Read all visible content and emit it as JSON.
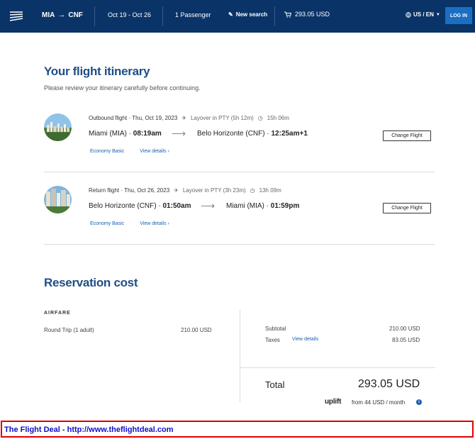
{
  "header": {
    "origin": "MIA",
    "destination": "CNF",
    "dates": "Oct 19 - Oct 26",
    "passengers": "1 Passenger",
    "new_search": "New search",
    "cart_total": "293.05 USD",
    "locale": "US / EN",
    "login": "LOG IN",
    "colors": {
      "header_bg": "#0a3468",
      "login_bg": "#1a6fc2"
    }
  },
  "itinerary": {
    "title": "Your flight itinerary",
    "subtitle": "Please review your itinerary carefully before continuing.",
    "flights": [
      {
        "label_bold": "Outbound flight",
        "date": " · Thu, Oct 19, 2023",
        "layover": "Layover in PTY (5h 12m)",
        "duration": "15h 06m",
        "origin": "Miami (MIA)",
        "depart_time": "08:19am",
        "destination": "Belo Horizonte (CNF)",
        "arrive_time": "12:25am+1",
        "fare": "Economy Basic",
        "details": "View details",
        "change": "Change Flight"
      },
      {
        "label_bold": "Return flight",
        "date": " · Thu, Oct 26, 2023",
        "layover": "Layover in PTY (3h 23m)",
        "duration": "13h 09m",
        "origin": "Belo Horizonte (CNF)",
        "depart_time": "01:50am",
        "destination": "Miami (MIA)",
        "arrive_time": "01:59pm",
        "fare": "Economy Basic",
        "details": "View details",
        "change": "Change Flight"
      }
    ]
  },
  "reservation": {
    "title": "Reservation cost",
    "airfare_heading": "AIRFARE",
    "trip_type": "Round Trip",
    "adults": "(1 adult)",
    "airfare_value": "210.00 USD",
    "subtotal_label": "Subtotal",
    "subtotal_value": "210.00 USD",
    "taxes_label": "Taxes",
    "taxes_link": "View details",
    "taxes_value": "83.05 USD",
    "total_label": "Total",
    "total_value": "293.05 USD",
    "uplift_brand": "uplift",
    "uplift_text": "from 44 USD  / month"
  },
  "banner": {
    "text": "The Flight Deal - http://www.theflightdeal.com"
  }
}
